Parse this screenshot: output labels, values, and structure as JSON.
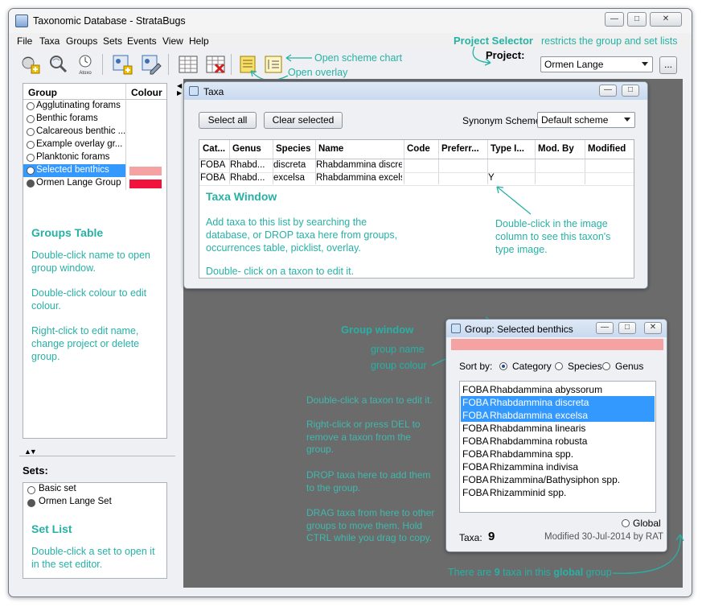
{
  "window": {
    "title": "Taxonomic Database - StrataBugs"
  },
  "menu": [
    "File",
    "Taxa",
    "Groups",
    "Sets",
    "Events",
    "View",
    "Help"
  ],
  "toolbar_icons": [
    "add-taxon-icon",
    "search-taxa-icon",
    "atoxo-clock-icon",
    "group-add-icon",
    "group-edit-icon",
    "table-icon",
    "table-delete-icon",
    "open-overlay-icon",
    "open-scheme-chart-icon"
  ],
  "atoxo_label": "Atoxo",
  "project": {
    "label": "Project:",
    "value": "Ormen Lange",
    "more_button": "..."
  },
  "callouts": {
    "project_selector_title": "Project Selector",
    "project_selector_text": "restricts the group and set lists",
    "open_scheme_chart": "Open scheme chart",
    "open_overlay": "Open overlay"
  },
  "groups_table": {
    "headers": {
      "group": "Group",
      "colour": "Colour"
    },
    "rows": [
      {
        "name": "Agglutinating forams",
        "colour": "",
        "filled": false
      },
      {
        "name": "Benthic forams",
        "colour": "",
        "filled": false
      },
      {
        "name": "Calcareous benthic ...",
        "colour": "",
        "filled": false
      },
      {
        "name": "Example overlay gr...",
        "colour": "",
        "filled": false
      },
      {
        "name": "Planktonic forams",
        "colour": "",
        "filled": false
      },
      {
        "name": "Selected benthics",
        "colour": "#f4a2a2",
        "filled": false,
        "selected": true
      },
      {
        "name": "Ormen Lange Group",
        "colour": "#f0143c",
        "filled": true
      }
    ],
    "note_title": "Groups Table",
    "note_1": "Double-click name to open group window.",
    "note_2": "Double-click colour to edit colour.",
    "note_3": "Right-click to edit name, change project or delete group."
  },
  "sets": {
    "title": "Sets:",
    "items": [
      {
        "name": "Basic set",
        "filled": false
      },
      {
        "name": "Ormen Lange Set",
        "filled": true
      }
    ],
    "note_title": "Set List",
    "note_1": "Double-click a set to open it in the set editor."
  },
  "taxa_window": {
    "title": "Taxa",
    "select_all": "Select all",
    "clear_selected": "Clear selected",
    "synonym_label": "Synonym Scheme:",
    "synonym_value": "Default scheme",
    "columns": [
      "Cat...",
      "Genus",
      "Species",
      "Name",
      "Code",
      "Preferr...",
      "Type I...",
      "Mod. By",
      "Modified"
    ],
    "rows": [
      [
        "FOBA",
        "Rhabd...",
        "discreta",
        "Rhabdammina discreta",
        "",
        "",
        "",
        "",
        ""
      ],
      [
        "FOBA",
        "Rhabd...",
        "excelsa",
        "Rhabdammina excelsa",
        "",
        "",
        "Y",
        "",
        ""
      ]
    ],
    "note_title": "Taxa Window",
    "note_1": "Add taxa to this list by searching the database, or DROP taxa here from groups, occurrences table, picklist, overlay.",
    "note_2": "Double- click on a taxon to edit it.",
    "note_3": "Double-click in the image column to see this taxon's type image."
  },
  "group_window": {
    "title": "Group: Selected benthics",
    "color": "#f4a2a2",
    "sort_by": "Sort by:",
    "sort_options": [
      "Category",
      "Species",
      "Genus"
    ],
    "taxa": [
      {
        "cat": "FOBA",
        "name": "Rhabdammina abyssorum",
        "selected": false
      },
      {
        "cat": "FOBA",
        "name": "Rhabdammina discreta",
        "selected": true
      },
      {
        "cat": "FOBA",
        "name": "Rhabdammina excelsa",
        "selected": true
      },
      {
        "cat": "FOBA",
        "name": "Rhabdammina linearis",
        "selected": false
      },
      {
        "cat": "FOBA",
        "name": "Rhabdammina robusta",
        "selected": false
      },
      {
        "cat": "FOBA",
        "name": "Rhabdammina spp.",
        "selected": false
      },
      {
        "cat": "FOBA",
        "name": "Rhizammina indivisa",
        "selected": false
      },
      {
        "cat": "FOBA",
        "name": "Rhizammina/Bathysiphon spp.",
        "selected": false
      },
      {
        "cat": "FOBA",
        "name": "Rhizamminid spp.",
        "selected": false
      }
    ],
    "global_label": "Global",
    "taxa_label": "Taxa:",
    "taxa_count": "9",
    "modified": "Modified 30-Jul-2014 by RAT"
  },
  "group_notes": {
    "title": "Group window",
    "group_name": "group name",
    "group_colour": "group colour",
    "d1": "Double-click a taxon to edit it.",
    "d2": "Right-click or press DEL to remove a taxon from the group.",
    "d3": "DROP taxa here to add them to the group.",
    "d4": "DRAG taxa from here to other groups to move them. Hold CTRL while you drag to copy.",
    "bottom_a": "There are",
    "bottom_b": "9",
    "bottom_c": "taxa in this",
    "bottom_d": "global",
    "bottom_e": "group"
  },
  "colors": {
    "accent_teal": "#27b1a5",
    "selection_blue": "#3399ff",
    "mdi_background": "#6b6b6b"
  }
}
